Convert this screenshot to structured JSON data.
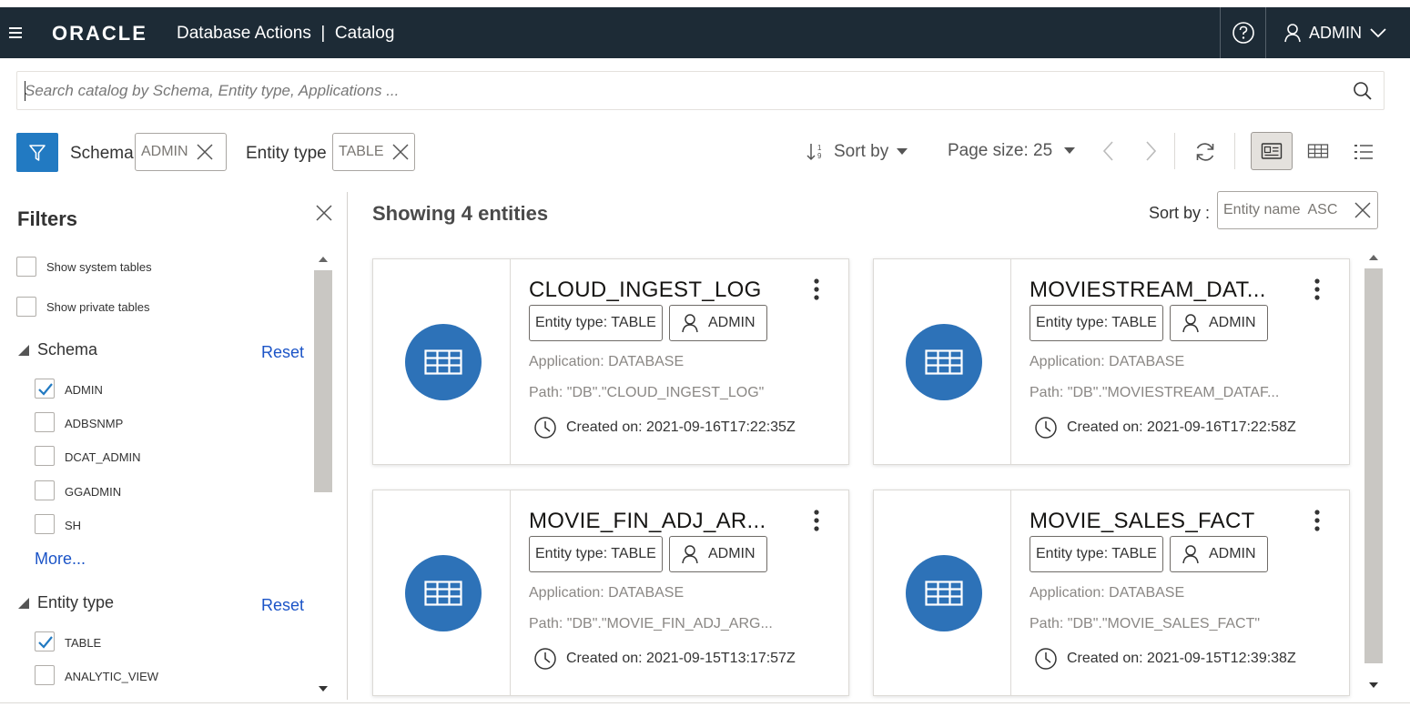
{
  "header": {
    "logo": "ORACLE",
    "app_title": "Database Actions  |  Catalog",
    "user": "ADMIN"
  },
  "search": {
    "placeholder": "Search catalog by Schema, Entity type, Applications ..."
  },
  "toolbar": {
    "schema_label": "Schema",
    "schema_value": "ADMIN",
    "entity_label": "Entity type",
    "entity_value": "TABLE",
    "sort_label": "Sort by",
    "page_size": "Page size: 25"
  },
  "filters": {
    "title": "Filters",
    "show_system": "Show system tables",
    "show_private": "Show private tables",
    "schema": {
      "title": "Schema",
      "reset": "Reset",
      "items": [
        {
          "label": "ADMIN",
          "checked": true
        },
        {
          "label": "ADBSNMP",
          "checked": false
        },
        {
          "label": "DCAT_ADMIN",
          "checked": false
        },
        {
          "label": "GGADMIN",
          "checked": false
        },
        {
          "label": "SH",
          "checked": false
        }
      ],
      "more": "More..."
    },
    "entity_type": {
      "title": "Entity type",
      "reset": "Reset",
      "items": [
        {
          "label": "TABLE",
          "checked": true
        },
        {
          "label": "ANALYTIC_VIEW",
          "checked": false
        }
      ]
    }
  },
  "results": {
    "showing": "Showing 4 entities",
    "sort_label": "Sort by :",
    "sort_value": "Entity name  ASC",
    "cards": [
      {
        "name": "CLOUD_INGEST_LOG",
        "entity_type": "Entity type: TABLE",
        "owner": "ADMIN",
        "application": "Application: DATABASE",
        "path": "Path: \"DB\".\"CLOUD_INGEST_LOG\"",
        "created": "Created on: 2021-09-16T17:22:35Z"
      },
      {
        "name": "MOVIESTREAM_DAT...",
        "entity_type": "Entity type: TABLE",
        "owner": "ADMIN",
        "application": "Application: DATABASE",
        "path": "Path: \"DB\".\"MOVIESTREAM_DATAF...",
        "created": "Created on: 2021-09-16T17:22:58Z"
      },
      {
        "name": "MOVIE_FIN_ADJ_AR...",
        "entity_type": "Entity type: TABLE",
        "owner": "ADMIN",
        "application": "Application: DATABASE",
        "path": "Path: \"DB\".\"MOVIE_FIN_ADJ_ARG...",
        "created": "Created on: 2021-09-15T13:17:57Z"
      },
      {
        "name": "MOVIE_SALES_FACT",
        "entity_type": "Entity type: TABLE",
        "owner": "ADMIN",
        "application": "Application: DATABASE",
        "path": "Path: \"DB\".\"MOVIE_SALES_FACT\"",
        "created": "Created on: 2021-09-15T12:39:38Z"
      }
    ]
  },
  "colors": {
    "header_bg": "#1d2b36",
    "accent": "#227ac2",
    "entity_circle": "#2d72b8",
    "link": "#1b54c7"
  }
}
